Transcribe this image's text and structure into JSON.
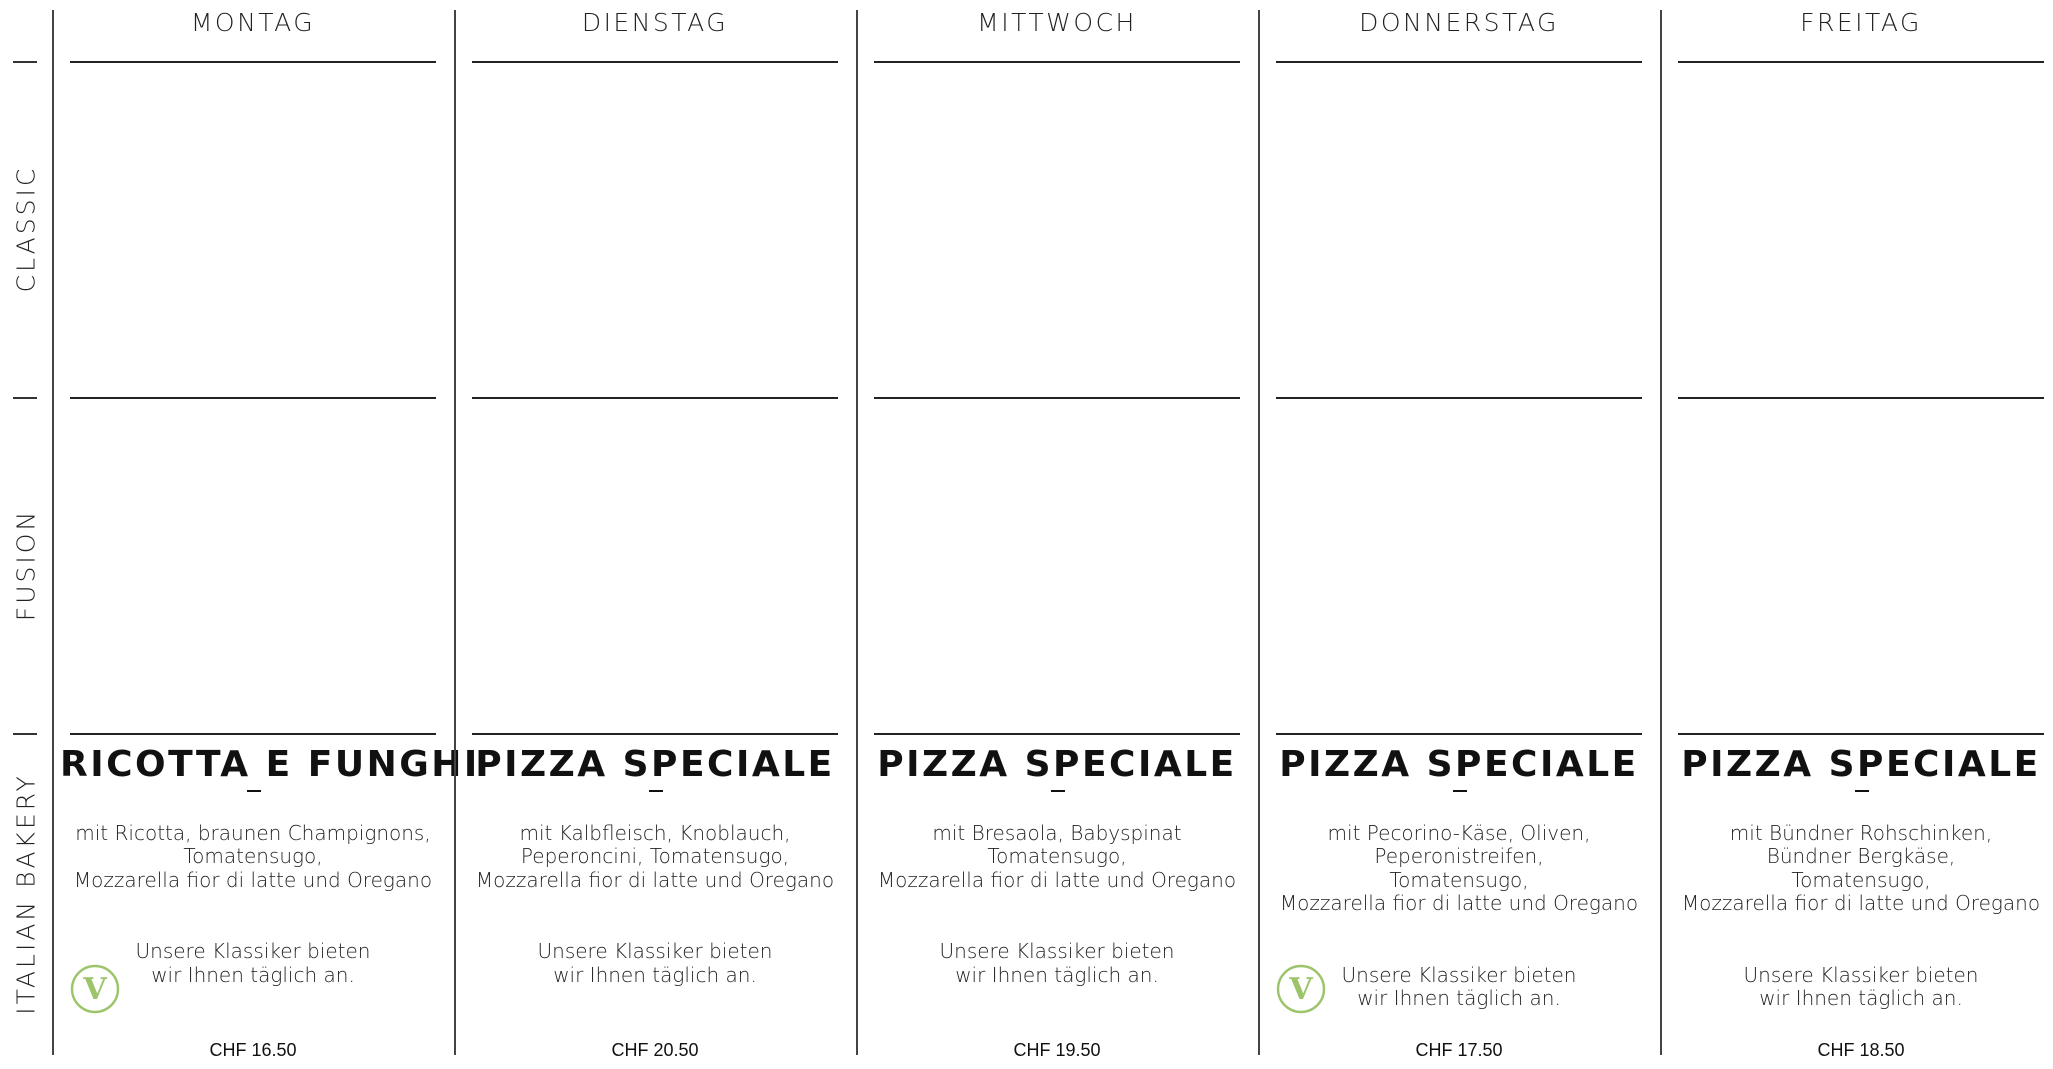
{
  "categories": {
    "classic": "CLASSIC",
    "fusion": "FUSION",
    "italian_bakery": "ITALIAN BAKERY"
  },
  "accent_color": "#9cc46a",
  "days": [
    {
      "name": "MONTAG",
      "dish": "RICOTTA E FUNGHI",
      "description": "mit Ricotta, braunen Champignons,\nTomatensugo,\nMozzarella fior di latte und Oregano",
      "note": "Unsere Klassiker bieten\nwir Ihnen täglich an.",
      "vegetarian": true,
      "veg_letter": "V",
      "price": "CHF 16.50"
    },
    {
      "name": "DIENSTAG",
      "dish": "PIZZA SPECIALE",
      "description": "mit Kalbfleisch, Knoblauch,\nPeperoncini, Tomatensugo,\nMozzarella fior di latte und Oregano",
      "note": "Unsere Klassiker bieten\nwir Ihnen täglich an.",
      "vegetarian": false,
      "veg_letter": "",
      "price": "CHF 20.50"
    },
    {
      "name": "MITTWOCH",
      "dish": "PIZZA SPECIALE",
      "description": "mit Bresaola, Babyspinat\nTomatensugo,\nMozzarella fior di latte und Oregano",
      "note": "Unsere Klassiker bieten\nwir Ihnen täglich an.",
      "vegetarian": false,
      "veg_letter": "",
      "price": "CHF 19.50"
    },
    {
      "name": "DONNERSTAG",
      "dish": "PIZZA SPECIALE",
      "description": "mit Pecorino-Käse, Oliven,\nPeperonistreifen,\nTomatensugo,\nMozzarella fior di latte und Oregano",
      "note": "Unsere Klassiker bieten\nwir Ihnen täglich an.",
      "vegetarian": true,
      "veg_letter": "V",
      "price": "CHF 17.50"
    },
    {
      "name": "FREITAG",
      "dish": "PIZZA SPECIALE",
      "description": "mit Bündner Rohschinken,\nBündner Bergkäse,\nTomatensugo,\nMozzarella fior di latte und Oregano",
      "note": "Unsere Klassiker bieten\nwir Ihnen täglich an.",
      "vegetarian": false,
      "veg_letter": "",
      "price": "CHF 18.50"
    }
  ]
}
